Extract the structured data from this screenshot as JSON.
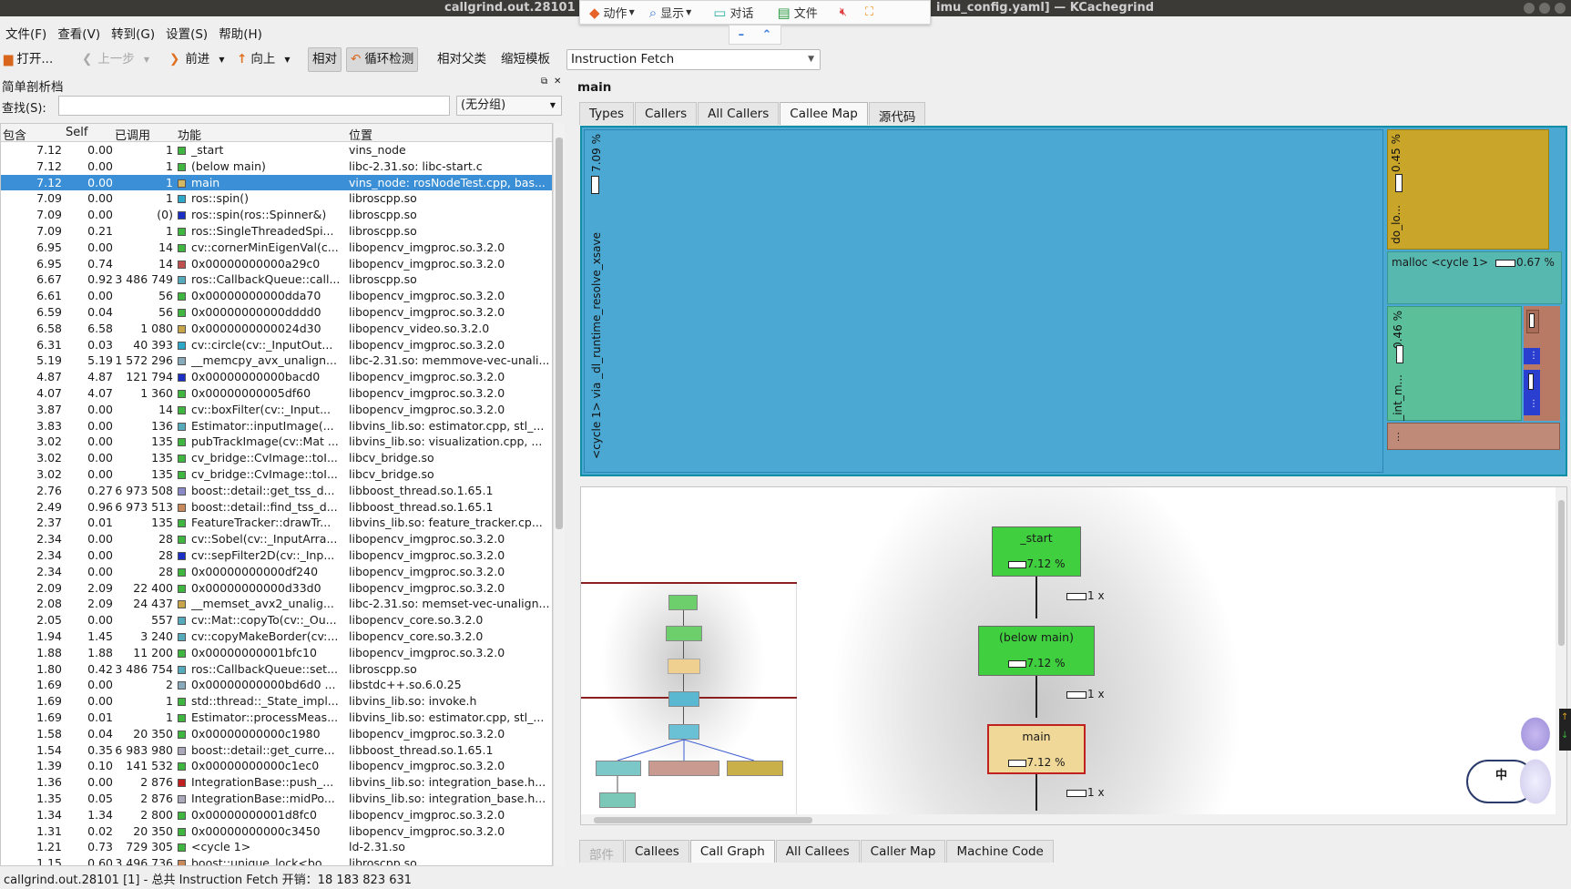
{
  "window": {
    "title_left": "callgrind.out.28101 [dev",
    "title_right": "imu_config.yaml] — KCachegrind"
  },
  "floatbar": {
    "items": [
      "动作",
      "显示",
      "对话",
      "文件"
    ]
  },
  "menubar": [
    "文件(F)",
    "查看(V)",
    "转到(G)",
    "设置(S)",
    "帮助(H)"
  ],
  "toolbar": {
    "open": "打开...",
    "back": "上一步",
    "forward": "前进",
    "up": "向上",
    "relative": "相对",
    "cycle": "循环检测",
    "relative_parent": "相对父类",
    "shorten": "缩短模板",
    "event_type": "Instruction Fetch"
  },
  "left_panel": {
    "title": "简单剖析档",
    "search_label": "查找(S):",
    "search_value": "",
    "group_select": "(无分组)",
    "columns": [
      "包含",
      "Self",
      "已调用",
      "功能",
      "位置"
    ],
    "rows": [
      [
        "7.12",
        "0.00",
        "1",
        "_start",
        "vins_node",
        "#3fb63f"
      ],
      [
        "7.12",
        "0.00",
        "1",
        "(below main)",
        "libc-2.31.so: libc-start.c",
        "#3fb63f"
      ],
      [
        "7.12",
        "0.00",
        "1",
        "main",
        "vins_node: rosNodeTest.cpp, bas...",
        "#d4b864"
      ],
      [
        "7.09",
        "0.00",
        "1",
        "ros::spin()",
        "libroscpp.so",
        "#2da8c8"
      ],
      [
        "7.09",
        "0.00",
        "(0)",
        "ros::spin(ros::Spinner&)",
        "libroscpp.so",
        "#1c2fc4"
      ],
      [
        "7.09",
        "0.21",
        "1",
        "ros::SingleThreadedSpi...",
        "libroscpp.so",
        "#3fb63f"
      ],
      [
        "6.95",
        "0.00",
        "14",
        "cv::cornerMinEigenVal(c...",
        "libopencv_imgproc.so.3.2.0",
        "#3fb63f"
      ],
      [
        "6.95",
        "0.74",
        "14",
        "0x00000000000a29c0",
        "libopencv_imgproc.so.3.2.0",
        "#c0504d"
      ],
      [
        "6.67",
        "0.92",
        "3 486 749",
        "ros::CallbackQueue::call...",
        "libroscpp.so",
        "#5ab"
      ],
      [
        "6.61",
        "0.00",
        "56",
        "0x00000000000dda70",
        "libopencv_imgproc.so.3.2.0",
        "#3fb63f"
      ],
      [
        "6.59",
        "0.04",
        "56",
        "0x00000000000dddd0",
        "libopencv_imgproc.so.3.2.0",
        "#3fb63f"
      ],
      [
        "6.58",
        "6.58",
        "1 080",
        "0x0000000000024d30",
        "libopencv_video.so.3.2.0",
        "#c9a54a"
      ],
      [
        "6.31",
        "0.03",
        "40 393",
        "cv::circle(cv::_InputOut...",
        "libopencv_imgproc.so.3.2.0",
        "#2da8c8"
      ],
      [
        "5.19",
        "5.19",
        "1 572 296",
        "__memcpy_avx_unalign...",
        "libc-2.31.so: memmove-vec-unali...",
        "#8ab"
      ],
      [
        "4.87",
        "4.87",
        "121 794",
        "0x00000000000bacd0",
        "libopencv_imgproc.so.3.2.0",
        "#1c2fc4"
      ],
      [
        "4.07",
        "4.07",
        "1 360",
        "0x00000000005df60",
        "libopencv_imgproc.so.3.2.0",
        "#3fb63f"
      ],
      [
        "3.87",
        "0.00",
        "14",
        "cv::boxFilter(cv::_Input...",
        "libopencv_imgproc.so.3.2.0",
        "#3fb63f"
      ],
      [
        "3.83",
        "0.00",
        "136",
        "Estimator::inputImage(...",
        "libvins_lib.so: estimator.cpp, stl_...",
        "#5ab"
      ],
      [
        "3.02",
        "0.00",
        "135",
        "pubTrackImage(cv::Mat ...",
        "libvins_lib.so: visualization.cpp, ...",
        "#3fb63f"
      ],
      [
        "3.02",
        "0.00",
        "135",
        "cv_bridge::CvImage::toI...",
        "libcv_bridge.so",
        "#3fb63f"
      ],
      [
        "3.02",
        "0.00",
        "135",
        "cv_bridge::CvImage::toI...",
        "libcv_bridge.so",
        "#3fb63f"
      ],
      [
        "2.76",
        "0.27",
        "6 973 508",
        "boost::detail::get_tss_d...",
        "libboost_thread.so.1.65.1",
        "#8a8ac8"
      ],
      [
        "2.49",
        "0.96",
        "6 973 513",
        "boost::detail::find_tss_d...",
        "libboost_thread.so.1.65.1",
        "#c88a5a"
      ],
      [
        "2.37",
        "0.01",
        "135",
        "FeatureTracker::drawTr...",
        "libvins_lib.so: feature_tracker.cp...",
        "#3fb63f"
      ],
      [
        "2.34",
        "0.00",
        "28",
        "cv::Sobel(cv::_InputArra...",
        "libopencv_imgproc.so.3.2.0",
        "#3fb63f"
      ],
      [
        "2.34",
        "0.00",
        "28",
        "cv::sepFilter2D(cv::_Inp...",
        "libopencv_imgproc.so.3.2.0",
        "#1c2fc4"
      ],
      [
        "2.34",
        "0.00",
        "28",
        "0x00000000000df240",
        "libopencv_imgproc.so.3.2.0",
        "#3fb63f"
      ],
      [
        "2.09",
        "2.09",
        "22 400",
        "0x00000000000d33d0",
        "libopencv_imgproc.so.3.2.0",
        "#3fb63f"
      ],
      [
        "2.08",
        "2.09",
        "24 437",
        "__memset_avx2_unalig...",
        "libc-2.31.so: memset-vec-unalign...",
        "#c9a54a"
      ],
      [
        "2.05",
        "0.00",
        "557",
        "cv::Mat::copyTo(cv::_Ou...",
        "libopencv_core.so.3.2.0",
        "#5ab"
      ],
      [
        "1.94",
        "1.45",
        "3 240",
        "cv::copyMakeBorder(cv:...",
        "libopencv_core.so.3.2.0",
        "#5ab"
      ],
      [
        "1.88",
        "1.88",
        "11 200",
        "0x00000000001bfc10",
        "libopencv_imgproc.so.3.2.0",
        "#3fb63f"
      ],
      [
        "1.80",
        "0.42",
        "3 486 754",
        "ros::CallbackQueue::set...",
        "libroscpp.so",
        "#5ab"
      ],
      [
        "1.69",
        "0.00",
        "2",
        "0x00000000000bd6d0 ...",
        "libstdc++.so.6.0.25",
        "#8ab"
      ],
      [
        "1.69",
        "0.00",
        "1",
        "std::thread::_State_impl...",
        "libvins_lib.so: invoke.h",
        "#3fb63f"
      ],
      [
        "1.69",
        "0.01",
        "1",
        "Estimator::processMeas...",
        "libvins_lib.so: estimator.cpp, stl_...",
        "#3fb63f"
      ],
      [
        "1.58",
        "0.04",
        "20 350",
        "0x00000000000c1980",
        "libopencv_imgproc.so.3.2.0",
        "#3fb63f"
      ],
      [
        "1.54",
        "0.35",
        "6 983 980",
        "boost::detail::get_curre...",
        "libboost_thread.so.1.65.1",
        "#aab"
      ],
      [
        "1.39",
        "0.10",
        "141 532",
        "0x00000000000c1ec0",
        "libopencv_imgproc.so.3.2.0",
        "#3fb63f"
      ],
      [
        "1.36",
        "0.00",
        "2 876",
        "IntegrationBase::push_...",
        "libvins_lib.so: integration_base.h...",
        "#c02020"
      ],
      [
        "1.35",
        "0.05",
        "2 876",
        "IntegrationBase::midPo...",
        "libvins_lib.so: integration_base.h...",
        "#aab"
      ],
      [
        "1.34",
        "1.34",
        "2 800",
        "0x00000000001d8fc0",
        "libopencv_imgproc.so.3.2.0",
        "#3fb63f"
      ],
      [
        "1.31",
        "0.02",
        "20 350",
        "0x00000000000c3450",
        "libopencv_imgproc.so.3.2.0",
        "#3fb63f"
      ],
      [
        "1.21",
        "0.73",
        "729 305",
        "<cycle 1>",
        "ld-2.31.so",
        "#3fb63f"
      ],
      [
        "1.15",
        "0.60",
        "3 496 736",
        "boost::unique_lock<bo...",
        "libroscpp.so",
        "#c88a5a"
      ]
    ]
  },
  "right_panel": {
    "function_name": "main",
    "top_tabs": [
      "Types",
      "Callers",
      "All Callers",
      "Callee Map",
      "源代码"
    ],
    "callee_map": {
      "main_label": "<cycle 1> via _dl_runtime_resolve_xsave",
      "main_pct": "7.09 %",
      "do_lo_label": "do_lo...",
      "do_lo_pct": "0.45 %",
      "malloc_label": "malloc <cycle 1>",
      "malloc_pct": "0.67 %",
      "int_m_label": "_int_m...",
      "int_m_pct": "0.46 %",
      "ellipsis": "⋮"
    },
    "call_graph": {
      "nodes": [
        {
          "name": "_start",
          "pct": "7.12 %"
        },
        {
          "name": "(below main)",
          "pct": "7.12 %"
        },
        {
          "name": "main",
          "pct": "7.12 %"
        }
      ],
      "edge_label": "1 x"
    },
    "bottom_tabs": [
      "部件",
      "Callees",
      "Call Graph",
      "All Callees",
      "Caller Map",
      "Machine Code"
    ]
  },
  "statusbar": "callgrind.out.28101 [1] - 总共 Instruction Fetch 开销：18 183 823 631",
  "ime": {
    "label": "中"
  },
  "colors": {
    "selection": "#3a8fd6",
    "map_blue": "#4ba8d2",
    "map_gold": "#c9a62a",
    "map_green": "#5bbf9a",
    "node_green": "#3fcf3f",
    "node_main": "#f0d898"
  }
}
